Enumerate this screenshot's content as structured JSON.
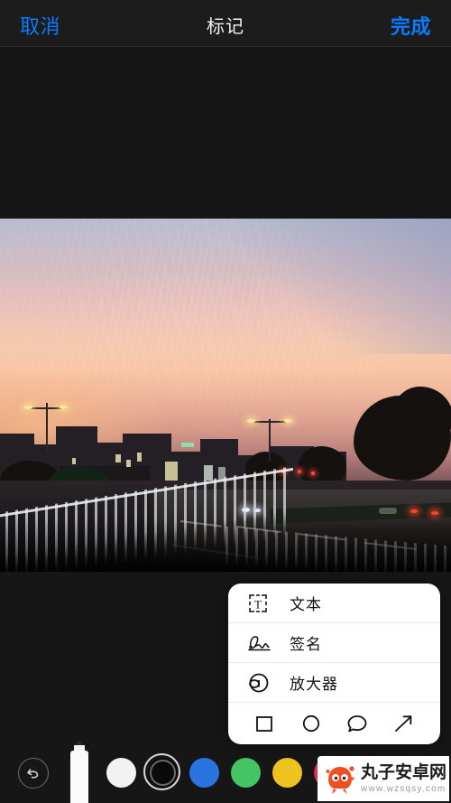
{
  "navbar": {
    "cancel_label": "取消",
    "title": "标记",
    "done_label": "完成"
  },
  "photo": {
    "description": "城市街道日落照片",
    "alt": "Sunset city street with fence, road and trees"
  },
  "popup": {
    "items": [
      {
        "label": "文本",
        "icon": "text-box-icon"
      },
      {
        "label": "签名",
        "icon": "signature-icon"
      },
      {
        "label": "放大器",
        "icon": "magnifier-icon"
      }
    ],
    "shapes": [
      {
        "name": "square-shape-icon"
      },
      {
        "name": "circle-shape-icon"
      },
      {
        "name": "speech-bubble-shape-icon"
      },
      {
        "name": "arrow-shape-icon"
      }
    ]
  },
  "toolbar": {
    "undo_icon": "undo-icon",
    "pen_tool": "marker-pen-tool",
    "colors": [
      {
        "name": "white",
        "hex": "#f2f2f2",
        "selected": false
      },
      {
        "name": "black",
        "hex": "#0a0a0a",
        "selected": true
      },
      {
        "name": "blue",
        "hex": "#2a74e0",
        "selected": false
      },
      {
        "name": "green",
        "hex": "#45c463",
        "selected": false
      },
      {
        "name": "yellow",
        "hex": "#eec21f",
        "selected": false
      },
      {
        "name": "red",
        "hex": "#ed2a47",
        "selected": false
      }
    ]
  },
  "watermark": {
    "title": "丸子安卓网",
    "url": "www.wzsqsy.com",
    "logo_color": "#f04e23"
  }
}
